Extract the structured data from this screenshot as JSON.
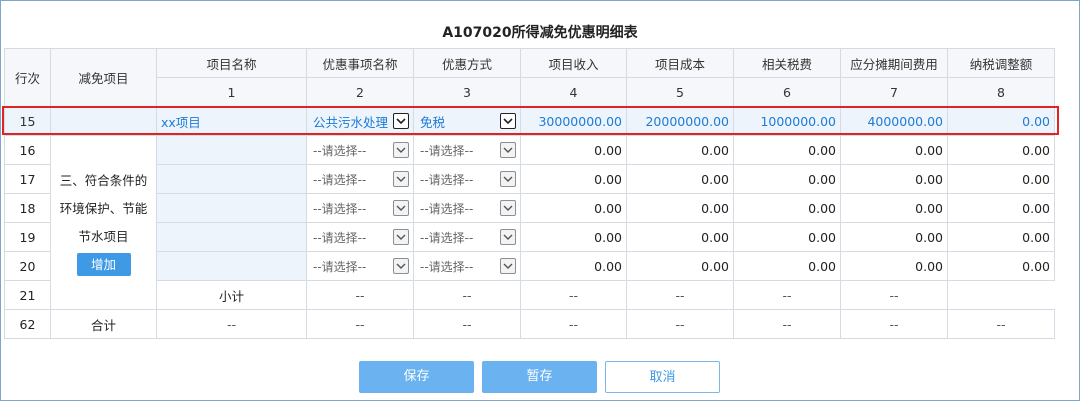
{
  "title": "A107020所得减免优惠明细表",
  "headers": {
    "row_no": "行次",
    "project_type": "减免项目",
    "project_name": "项目名称",
    "item_name": "优惠事项名称",
    "method": "优惠方式",
    "income": "项目收入",
    "cost": "项目成本",
    "tax": "相关税费",
    "period_cost": "应分摊期间费用",
    "adjustment": "纳税调整额",
    "nums": [
      "1",
      "2",
      "3",
      "4",
      "5",
      "6",
      "7",
      "8"
    ]
  },
  "highlight_row": {
    "row_no": "15",
    "project_name": "xx项目",
    "item_name": "公共污水处理",
    "method": "免税",
    "income": "30000000.00",
    "cost": "20000000.00",
    "tax": "1000000.00",
    "period_cost": "4000000.00",
    "adjustment": "0.00"
  },
  "group": {
    "label_lines": [
      "三、符合条件的",
      "环境保护、节能",
      "节水项目"
    ],
    "add_label": "增加"
  },
  "rows": [
    {
      "row_no": "16",
      "item_name": "--请选择--",
      "method": "--请选择--",
      "income": "0.00",
      "cost": "0.00",
      "tax": "0.00",
      "period_cost": "0.00",
      "adjustment": "0.00"
    },
    {
      "row_no": "17",
      "item_name": "--请选择--",
      "method": "--请选择--",
      "income": "0.00",
      "cost": "0.00",
      "tax": "0.00",
      "period_cost": "0.00",
      "adjustment": "0.00"
    },
    {
      "row_no": "18",
      "item_name": "--请选择--",
      "method": "--请选择--",
      "income": "0.00",
      "cost": "0.00",
      "tax": "0.00",
      "period_cost": "0.00",
      "adjustment": "0.00"
    },
    {
      "row_no": "19",
      "item_name": "--请选择--",
      "method": "--请选择--",
      "income": "0.00",
      "cost": "0.00",
      "tax": "0.00",
      "period_cost": "0.00",
      "adjustment": "0.00"
    },
    {
      "row_no": "20",
      "item_name": "--请选择--",
      "method": "--请选择--",
      "income": "0.00",
      "cost": "0.00",
      "tax": "0.00",
      "period_cost": "0.00",
      "adjustment": "0.00"
    }
  ],
  "subtotal": {
    "row_no": "21",
    "label": "小计",
    "dash": "--"
  },
  "total": {
    "row_no": "62",
    "label": "合计",
    "dash": "--"
  },
  "buttons": {
    "save": "保存",
    "temp_save": "暂存",
    "cancel": "取消"
  },
  "colors": {
    "accent": "#3f9ae6",
    "highlight_border": "#e02424",
    "highlight_bg": "#edf4fc"
  },
  "icons": {
    "dropdown": "chevron-down-icon"
  }
}
